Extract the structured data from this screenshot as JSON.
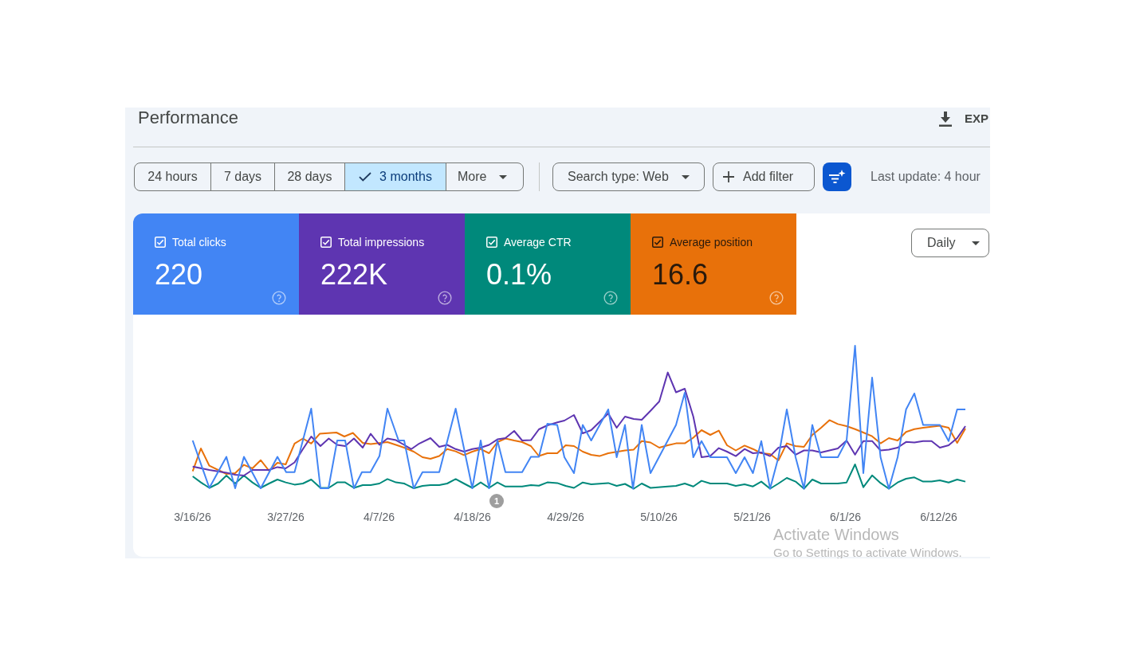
{
  "header": {
    "title": "Performance",
    "export_label": "EXP"
  },
  "date_ranges": [
    {
      "label": "24 hours",
      "kind": "range",
      "selected": false
    },
    {
      "label": "7 days",
      "kind": "range",
      "selected": false
    },
    {
      "label": "28 days",
      "kind": "range",
      "selected": false
    },
    {
      "label": "3 months",
      "kind": "range",
      "selected": true
    },
    {
      "label": "More",
      "kind": "menu",
      "selected": false
    }
  ],
  "search_type": "Search type: Web",
  "add_filter": "Add filter",
  "last_update": "Last update: 4 hour",
  "metrics": [
    {
      "label": "Total clicks",
      "value": "220",
      "checked": true,
      "color": "#4285f4"
    },
    {
      "label": "Total impressions",
      "value": "222K",
      "checked": true,
      "color": "#5e35b1"
    },
    {
      "label": "Average CTR",
      "value": "0.1%",
      "checked": true,
      "color": "#00897b"
    },
    {
      "label": "Average position",
      "value": "16.6",
      "checked": true,
      "color": "#e8710a"
    }
  ],
  "granularity": "Daily",
  "chart": {
    "x_labels": [
      "3/16/26",
      "3/27/26",
      "4/7/26",
      "4/18/26",
      "4/29/26",
      "5/10/26",
      "5/21/26",
      "6/1/26",
      "6/12/26"
    ],
    "annotations": [
      "1"
    ]
  },
  "system_notice": {
    "title": "Activate Windows",
    "message": "Go to Settings to activate Windows."
  }
}
